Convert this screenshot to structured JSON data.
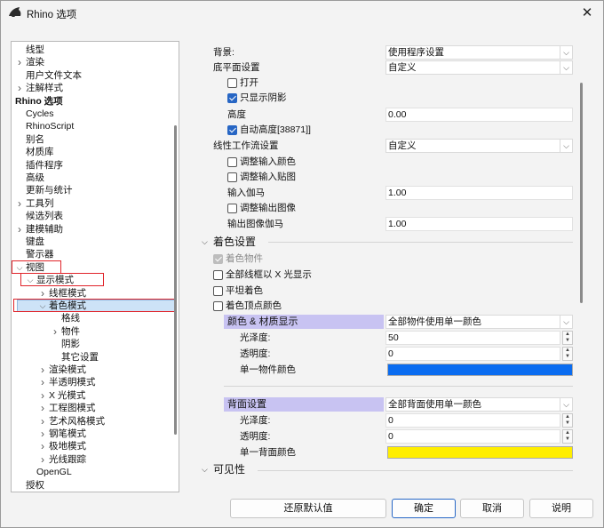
{
  "window": {
    "title": "Rhino 选项"
  },
  "tree": {
    "items": [
      {
        "label": "线型",
        "indent": 0,
        "arrow": ""
      },
      {
        "label": "渲染",
        "indent": 0,
        "arrow": "right"
      },
      {
        "label": "用户文件文本",
        "indent": 0,
        "arrow": ""
      },
      {
        "label": "注解样式",
        "indent": 0,
        "arrow": "right"
      },
      {
        "label": "Rhino 选项",
        "indent": -1,
        "arrow": "",
        "bold": true
      },
      {
        "label": "Cycles",
        "indent": 0,
        "arrow": ""
      },
      {
        "label": "RhinoScript",
        "indent": 0,
        "arrow": ""
      },
      {
        "label": "别名",
        "indent": 0,
        "arrow": ""
      },
      {
        "label": "材质库",
        "indent": 0,
        "arrow": ""
      },
      {
        "label": "插件程序",
        "indent": 0,
        "arrow": ""
      },
      {
        "label": "高级",
        "indent": 0,
        "arrow": ""
      },
      {
        "label": "更新与统计",
        "indent": 0,
        "arrow": ""
      },
      {
        "label": "工具列",
        "indent": 0,
        "arrow": "right"
      },
      {
        "label": "候选列表",
        "indent": 0,
        "arrow": ""
      },
      {
        "label": "建模辅助",
        "indent": 0,
        "arrow": "right"
      },
      {
        "label": "键盘",
        "indent": 0,
        "arrow": ""
      },
      {
        "label": "警示器",
        "indent": 0,
        "arrow": ""
      },
      {
        "label": "视图",
        "indent": 0,
        "arrow": "down"
      },
      {
        "label": "显示模式",
        "indent": 1,
        "arrow": "down"
      },
      {
        "label": "线框模式",
        "indent": 2,
        "arrow": "right"
      },
      {
        "label": "着色模式",
        "indent": 2,
        "arrow": "down",
        "selected": true
      },
      {
        "label": "格线",
        "indent": 3,
        "arrow": ""
      },
      {
        "label": "物件",
        "indent": 3,
        "arrow": "right"
      },
      {
        "label": "阴影",
        "indent": 3,
        "arrow": ""
      },
      {
        "label": "其它设置",
        "indent": 3,
        "arrow": ""
      },
      {
        "label": "渲染模式",
        "indent": 2,
        "arrow": "right"
      },
      {
        "label": "半透明模式",
        "indent": 2,
        "arrow": "right"
      },
      {
        "label": "X 光模式",
        "indent": 2,
        "arrow": "right"
      },
      {
        "label": "工程图模式",
        "indent": 2,
        "arrow": "right"
      },
      {
        "label": "艺术风格模式",
        "indent": 2,
        "arrow": "right"
      },
      {
        "label": "钢笔模式",
        "indent": 2,
        "arrow": "right"
      },
      {
        "label": "极地模式",
        "indent": 2,
        "arrow": "right"
      },
      {
        "label": "光线跟踪",
        "indent": 2,
        "arrow": "right"
      },
      {
        "label": "OpenGL",
        "indent": 1,
        "arrow": ""
      },
      {
        "label": "授权",
        "indent": 0,
        "arrow": ""
      }
    ]
  },
  "settings": {
    "background_label": "背景:",
    "background_value": "使用程序设置",
    "ground_plane_label": "底平面设置",
    "ground_plane_value": "自定义",
    "on_label": "打开",
    "shadows_only_label": "只显示阴影",
    "height_label": "高度",
    "height_value": "0.00",
    "auto_height_label": "自动高度[38871]]",
    "linear_workflow_label": "线性工作流设置",
    "linear_workflow_value": "自定义",
    "adjust_input_color_label": "调整输入颜色",
    "adjust_input_texture_label": "调整输入贴图",
    "input_gamma_label": "输入伽马",
    "input_gamma_value": "1.00",
    "adjust_output_image_label": "调整输出图像",
    "output_gamma_label": "输出图像伽马",
    "output_gamma_value": "1.00",
    "shading_section": "着色设置",
    "shade_objects_label": "着色物件",
    "all_wireframe_xray_label": "全部线框以 X 光显示",
    "flat_shading_label": "平坦着色",
    "vertex_colors_label": "着色顶点颜色",
    "color_material_label": "颜色 & 材质显示",
    "color_material_value": "全部物件使用单一颜色",
    "gloss_label": "光泽度:",
    "gloss_value": "50",
    "transparency_label": "透明度:",
    "transparency_value": "0",
    "single_object_color_label": "单一物件颜色",
    "single_object_color": "#0a6cf0",
    "backface_label": "背面设置",
    "backface_value": "全部背面使用单一颜色",
    "back_gloss_label": "光泽度:",
    "back_gloss_value": "0",
    "back_transparency_label": "透明度:",
    "back_transparency_value": "0",
    "single_backface_color_label": "单一背面颜色",
    "single_backface_color": "#ffee00",
    "visibility_section": "可见性"
  },
  "buttons": {
    "restore_defaults": "还原默认值",
    "ok": "确定",
    "cancel": "取消",
    "help": "说明"
  }
}
